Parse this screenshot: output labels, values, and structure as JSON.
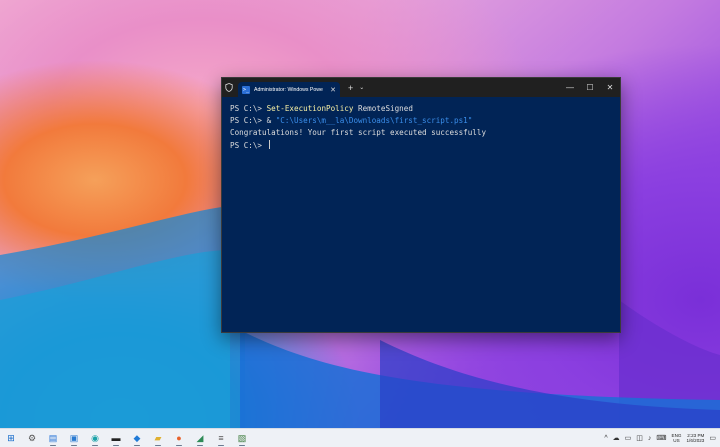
{
  "window": {
    "tab_label": "Administrator: Windows Powe",
    "tab_icon_glyph": ">_",
    "new_tab_glyph": "+",
    "dropdown_glyph": "⌄",
    "close_tab_glyph": "✕",
    "minimize_glyph": "—",
    "maximize_glyph": "☐",
    "close_glyph": "✕"
  },
  "console": {
    "line1_prompt": "PS C:\\> ",
    "line1_cmd": "Set-ExecutionPolicy",
    "line1_arg": " RemoteSigned",
    "line2_prompt": "PS C:\\> & ",
    "line2_path": "\"C:\\Users\\m__la\\Downloads\\first_script.ps1\"",
    "line3_output": "Congratulations! Your first script executed successfully",
    "line4_prompt": "PS C:\\> "
  },
  "taskbar": {
    "apps": [
      {
        "name": "start-icon",
        "glyph": "⊞",
        "color": "#0a64c8"
      },
      {
        "name": "settings-icon",
        "glyph": "⚙",
        "color": "#555555"
      },
      {
        "name": "file-explorer-icon",
        "glyph": "▤",
        "color": "#1f6fd6"
      },
      {
        "name": "store-icon",
        "glyph": "▣",
        "color": "#2a7ad0"
      },
      {
        "name": "edge-icon",
        "glyph": "◉",
        "color": "#1aa2a8"
      },
      {
        "name": "terminal-icon",
        "glyph": "▬",
        "color": "#222222"
      },
      {
        "name": "vscode-icon",
        "glyph": "◆",
        "color": "#1f7ad6"
      },
      {
        "name": "folder-icon",
        "glyph": "▰",
        "color": "#e0b030"
      },
      {
        "name": "firefox-icon",
        "glyph": "●",
        "color": "#e8622c"
      },
      {
        "name": "app-icon-1",
        "glyph": "◢",
        "color": "#2e8b57"
      },
      {
        "name": "app-icon-2",
        "glyph": "≡",
        "color": "#555555"
      },
      {
        "name": "app-icon-3",
        "glyph": "▧",
        "color": "#3a7a3a"
      }
    ],
    "tray": {
      "chevron": "^",
      "lang_line1": "ENG",
      "lang_line2": "US",
      "time": "2:23 PM",
      "date": "1/6/2023",
      "notification_glyph": "▭"
    }
  }
}
